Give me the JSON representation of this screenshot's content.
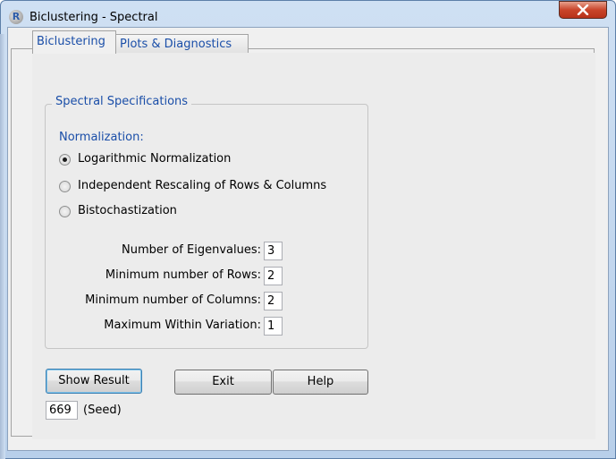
{
  "window": {
    "title": "Biclustering - Spectral"
  },
  "tabs": [
    {
      "label": "Biclustering",
      "active": true
    },
    {
      "label": "Plots & Diagnostics",
      "active": false
    }
  ],
  "spec": {
    "group_title": "Spectral Specifications",
    "normalization_label": "Normalization:",
    "options": [
      {
        "label": "Logarithmic Normalization",
        "selected": true
      },
      {
        "label": "Independent Rescaling of Rows & Columns",
        "selected": false
      },
      {
        "label": "Bistochastization",
        "selected": false
      }
    ],
    "fields": [
      {
        "label": "Number of Eigenvalues:",
        "value": "3"
      },
      {
        "label": "Minimum number of Rows:",
        "value": "2"
      },
      {
        "label": "Minimum number of Columns:",
        "value": "2"
      },
      {
        "label": "Maximum Within Variation:",
        "value": "1"
      }
    ]
  },
  "buttons": {
    "show_result": "Show Result",
    "exit": "Exit",
    "help": "Help"
  },
  "seed": {
    "value": "669",
    "label": "(Seed)"
  }
}
